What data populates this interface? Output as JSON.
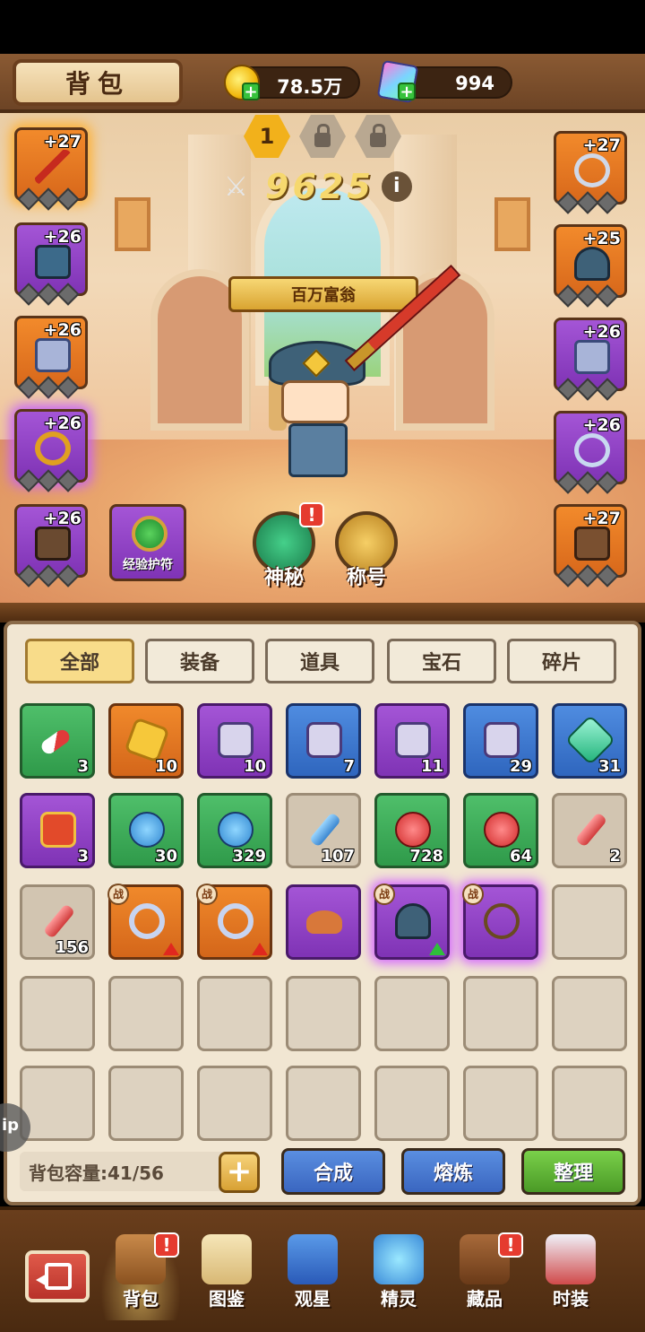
{
  "header": {
    "title": "背包",
    "gold_value": "78.5万",
    "gem_value": "994",
    "gold_icon": "gold-coin-icon",
    "gem_icon": "diamond-gem-icon"
  },
  "loadout_tabs": [
    {
      "label": "1",
      "active": true
    },
    {
      "label": "",
      "locked": true
    },
    {
      "label": "",
      "locked": true
    }
  ],
  "power": {
    "value": "9625",
    "info_label": "i"
  },
  "character_title": "百万富翁",
  "equipment_left": [
    {
      "level": "+27",
      "item": "sword-icon",
      "rarity": "orange"
    },
    {
      "level": "+26",
      "item": "armor-icon",
      "rarity": "purple"
    },
    {
      "level": "+26",
      "item": "bracer-icon",
      "rarity": "orange"
    },
    {
      "level": "+26",
      "item": "ring-icon",
      "rarity": "purple"
    },
    {
      "level": "+26",
      "item": "gloves-icon",
      "rarity": "purple"
    }
  ],
  "equipment_right": [
    {
      "level": "+27",
      "item": "necklace-icon",
      "rarity": "orange"
    },
    {
      "level": "+25",
      "item": "helmet-icon",
      "rarity": "orange"
    },
    {
      "level": "+26",
      "item": "bracer-icon",
      "rarity": "purple"
    },
    {
      "level": "+26",
      "item": "bracelet-icon",
      "rarity": "purple"
    },
    {
      "level": "+27",
      "item": "boots-icon",
      "rarity": "orange"
    }
  ],
  "amulet_slot": {
    "label": "经验护符"
  },
  "feature_buttons": [
    {
      "label": "神秘",
      "alert": "!"
    },
    {
      "label": "称号"
    }
  ],
  "filter_tabs": [
    {
      "label": "全部",
      "active": true
    },
    {
      "label": "装备"
    },
    {
      "label": "道具"
    },
    {
      "label": "宝石"
    },
    {
      "label": "碎片"
    }
  ],
  "inventory": [
    {
      "rarity": "green",
      "icon": "capsule-icon",
      "count": "3"
    },
    {
      "rarity": "orange",
      "icon": "gold-shard-icon",
      "count": "10"
    },
    {
      "rarity": "purple",
      "icon": "card-icon",
      "count": "10"
    },
    {
      "rarity": "blue",
      "icon": "card-icon",
      "count": "7"
    },
    {
      "rarity": "purple",
      "icon": "card-icon",
      "count": "11"
    },
    {
      "rarity": "blue",
      "icon": "card-icon",
      "count": "29"
    },
    {
      "rarity": "blue",
      "icon": "emerald-gem-icon",
      "count": "31"
    },
    {
      "rarity": "purple",
      "icon": "gem-box-icon",
      "count": "3"
    },
    {
      "rarity": "green",
      "icon": "blue-potion-icon",
      "count": "30"
    },
    {
      "rarity": "green",
      "icon": "blue-potion-icon",
      "count": "329"
    },
    {
      "rarity": "gray",
      "icon": "blue-vial-icon",
      "count": "107"
    },
    {
      "rarity": "green",
      "icon": "red-potion-icon",
      "count": "728"
    },
    {
      "rarity": "green",
      "icon": "red-potion-icon",
      "count": "64"
    },
    {
      "rarity": "gray",
      "icon": "red-vial-icon",
      "count": "2"
    },
    {
      "rarity": "gray",
      "icon": "red-vial-icon",
      "count": "156"
    },
    {
      "rarity": "orange",
      "icon": "bracelet-icon",
      "count": "",
      "tag": "战",
      "upgrade": "red"
    },
    {
      "rarity": "orange",
      "icon": "bracelet-icon",
      "count": "",
      "tag": "战",
      "upgrade": "red"
    },
    {
      "rarity": "purple",
      "icon": "cap-icon",
      "count": ""
    },
    {
      "rarity": "purple",
      "icon": "helmet-icon",
      "count": "",
      "tag": "战",
      "upgrade": "green",
      "glow": true
    },
    {
      "rarity": "purple",
      "icon": "necklace-icon",
      "count": "",
      "tag": "战",
      "glow": true
    },
    {
      "rarity": "empty",
      "icon": "",
      "count": ""
    }
  ],
  "empty_rows": 2,
  "capacity": {
    "label": "背包容量:41/56",
    "plus": "+"
  },
  "actions": [
    {
      "label": "合成",
      "color": "blue"
    },
    {
      "label": "熔炼",
      "color": "blue"
    },
    {
      "label": "整理",
      "color": "green"
    }
  ],
  "help_bubble": "ip",
  "bottom_nav": [
    {
      "label": "背包",
      "icon": "backpack-chest-icon",
      "active": true,
      "alert": "!"
    },
    {
      "label": "图鉴",
      "icon": "book-icon"
    },
    {
      "label": "观星",
      "icon": "star-gate-icon"
    },
    {
      "label": "精灵",
      "icon": "spirit-icon"
    },
    {
      "label": "藏品",
      "icon": "treasure-chest-icon",
      "alert": "!"
    },
    {
      "label": "时装",
      "icon": "costume-icon"
    }
  ],
  "colors": {
    "orange": "#f28a2b",
    "purple": "#a455d6",
    "green": "#4fbf6a",
    "blue": "#4f8ce0",
    "gold": "#f2b11b"
  }
}
